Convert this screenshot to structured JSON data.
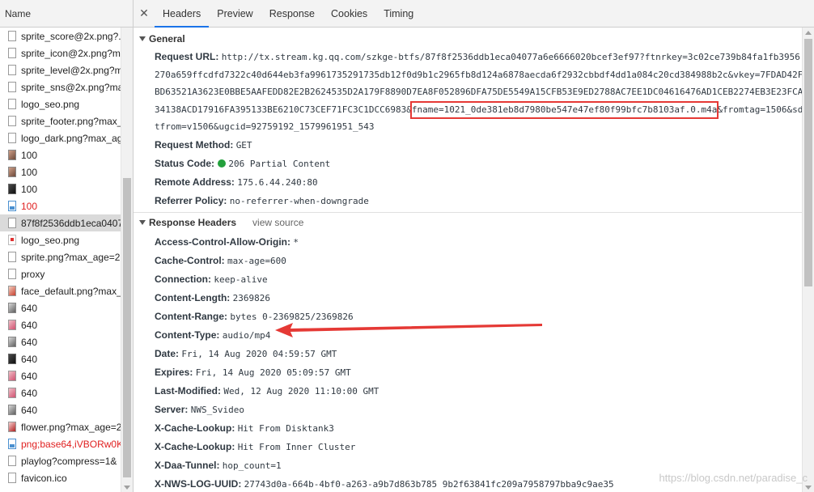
{
  "left_panel": {
    "header": "Name",
    "items": [
      {
        "name": "sprite_score@2x.png?...",
        "icon": "file-icon",
        "red": false
      },
      {
        "name": "sprite_icon@2x.png?ma",
        "icon": "file-icon",
        "red": false
      },
      {
        "name": "sprite_level@2x.png?m",
        "icon": "file-icon",
        "red": false
      },
      {
        "name": "sprite_sns@2x.png?ma",
        "icon": "file-icon",
        "red": false
      },
      {
        "name": "logo_seo.png",
        "icon": "file-icon",
        "red": false
      },
      {
        "name": "sprite_footer.png?max_",
        "icon": "file-icon",
        "red": false
      },
      {
        "name": "logo_dark.png?max_ag",
        "icon": "file-icon",
        "red": false
      },
      {
        "name": "100",
        "icon": "image-icon",
        "red": false
      },
      {
        "name": "100",
        "icon": "image-icon",
        "red": false
      },
      {
        "name": "100",
        "icon": "image-icon",
        "red": false
      },
      {
        "name": "100",
        "icon": "image-icon",
        "red": true
      },
      {
        "name": "87f8f2536ddb1eca0407",
        "icon": "file-icon",
        "red": false
      },
      {
        "name": "logo_seo.png",
        "icon": "file-icon",
        "red": false
      },
      {
        "name": "sprite.png?max_age=2",
        "icon": "file-icon",
        "red": false
      },
      {
        "name": "proxy",
        "icon": "file-icon",
        "red": false
      },
      {
        "name": "face_default.png?max_",
        "icon": "file-icon",
        "red": false
      },
      {
        "name": "640",
        "icon": "image-icon",
        "red": false
      },
      {
        "name": "640",
        "icon": "image-icon",
        "red": false
      },
      {
        "name": "640",
        "icon": "image-icon",
        "red": false
      },
      {
        "name": "640",
        "icon": "image-icon",
        "red": false
      },
      {
        "name": "640",
        "icon": "image-icon",
        "red": false
      },
      {
        "name": "640",
        "icon": "image-icon",
        "red": false
      },
      {
        "name": "640",
        "icon": "image-icon",
        "red": false
      },
      {
        "name": "flower.png?max_age=2",
        "icon": "image-icon",
        "red": false
      },
      {
        "name": "png;base64,iVBORw0K",
        "icon": "image-icon",
        "red": true
      },
      {
        "name": "playlog?compress=1&",
        "icon": "file-icon",
        "red": false
      },
      {
        "name": "favicon.ico",
        "icon": "file-icon",
        "red": false
      }
    ]
  },
  "tabs": {
    "close": "✕",
    "items": [
      "Headers",
      "Preview",
      "Response",
      "Cookies",
      "Timing"
    ],
    "active": "Headers"
  },
  "general": {
    "title": "General",
    "request_url_label": "Request URL:",
    "request_url_lines": [
      "http://tx.stream.kg.qq.com/szkge-btfs/87f8f2536ddb1eca04077a6e6666020bcef3ef97?ftnrkey=3c02ce739b84fa1fb3956",
      "270a659ffcdfd7322c40d644eb3fa9961735291735db12f0d9b1c2965fb8d124a6878aecda6f2932cbbdf4dd1a084c20cd384988b2c&vkey=7FDAD42F",
      "BD63521A3623E0BBE5AAFEDD82E2B2624535D2A179F8890D7EA8F052896DFA75DE5549A15CFB53E9ED2788AC7EE1DC04616476AD1CEB2274EB3E23FCA",
      "34138ACD17916FA395133BE6210C73CEF71FC3C1DCC6983&fname=1021_0de381eb8d7980be547e47ef80f99bfc7b8103af.0.m4a&fromtag=1506&sd",
      "tfrom=v1506&ugcid=92759192_1579961951_543"
    ],
    "request_method_label": "Request Method:",
    "request_method": "GET",
    "status_code_label": "Status Code:",
    "status_code": "206 Partial Content",
    "status_color": "#23a03c",
    "remote_address_label": "Remote Address:",
    "remote_address": "175.6.44.240:80",
    "referrer_policy_label": "Referrer Policy:",
    "referrer_policy": "no-referrer-when-downgrade"
  },
  "response_headers": {
    "title": "Response Headers",
    "view_source": "view source",
    "items": [
      {
        "key": "Access-Control-Allow-Origin:",
        "value": "*"
      },
      {
        "key": "Cache-Control:",
        "value": "max-age=600"
      },
      {
        "key": "Connection:",
        "value": "keep-alive"
      },
      {
        "key": "Content-Length:",
        "value": "2369826"
      },
      {
        "key": "Content-Range:",
        "value": "bytes 0-2369825/2369826"
      },
      {
        "key": "Content-Type:",
        "value": "audio/mp4"
      },
      {
        "key": "Date:",
        "value": "Fri, 14 Aug 2020 04:59:57 GMT"
      },
      {
        "key": "Expires:",
        "value": "Fri, 14 Aug 2020 05:09:57 GMT"
      },
      {
        "key": "Last-Modified:",
        "value": "Wed, 12 Aug 2020 11:10:00 GMT"
      },
      {
        "key": "Server:",
        "value": "NWS_Svideo"
      },
      {
        "key": "X-Cache-Lookup:",
        "value": "Hit From Disktank3"
      },
      {
        "key": "X-Cache-Lookup:",
        "value": "Hit From Inner Cluster"
      },
      {
        "key": "X-Daa-Tunnel:",
        "value": "hop_count=1"
      },
      {
        "key": "X-NWS-LOG-UUID:",
        "value": "27743d0a-664b-4bf0-a263-a9b7d863b785 9b2f63841fc209a7958797bba9c9ae35"
      }
    ]
  },
  "annotation": {
    "color": "#e53935"
  },
  "watermark": "https://blog.csdn.net/paradise_c"
}
